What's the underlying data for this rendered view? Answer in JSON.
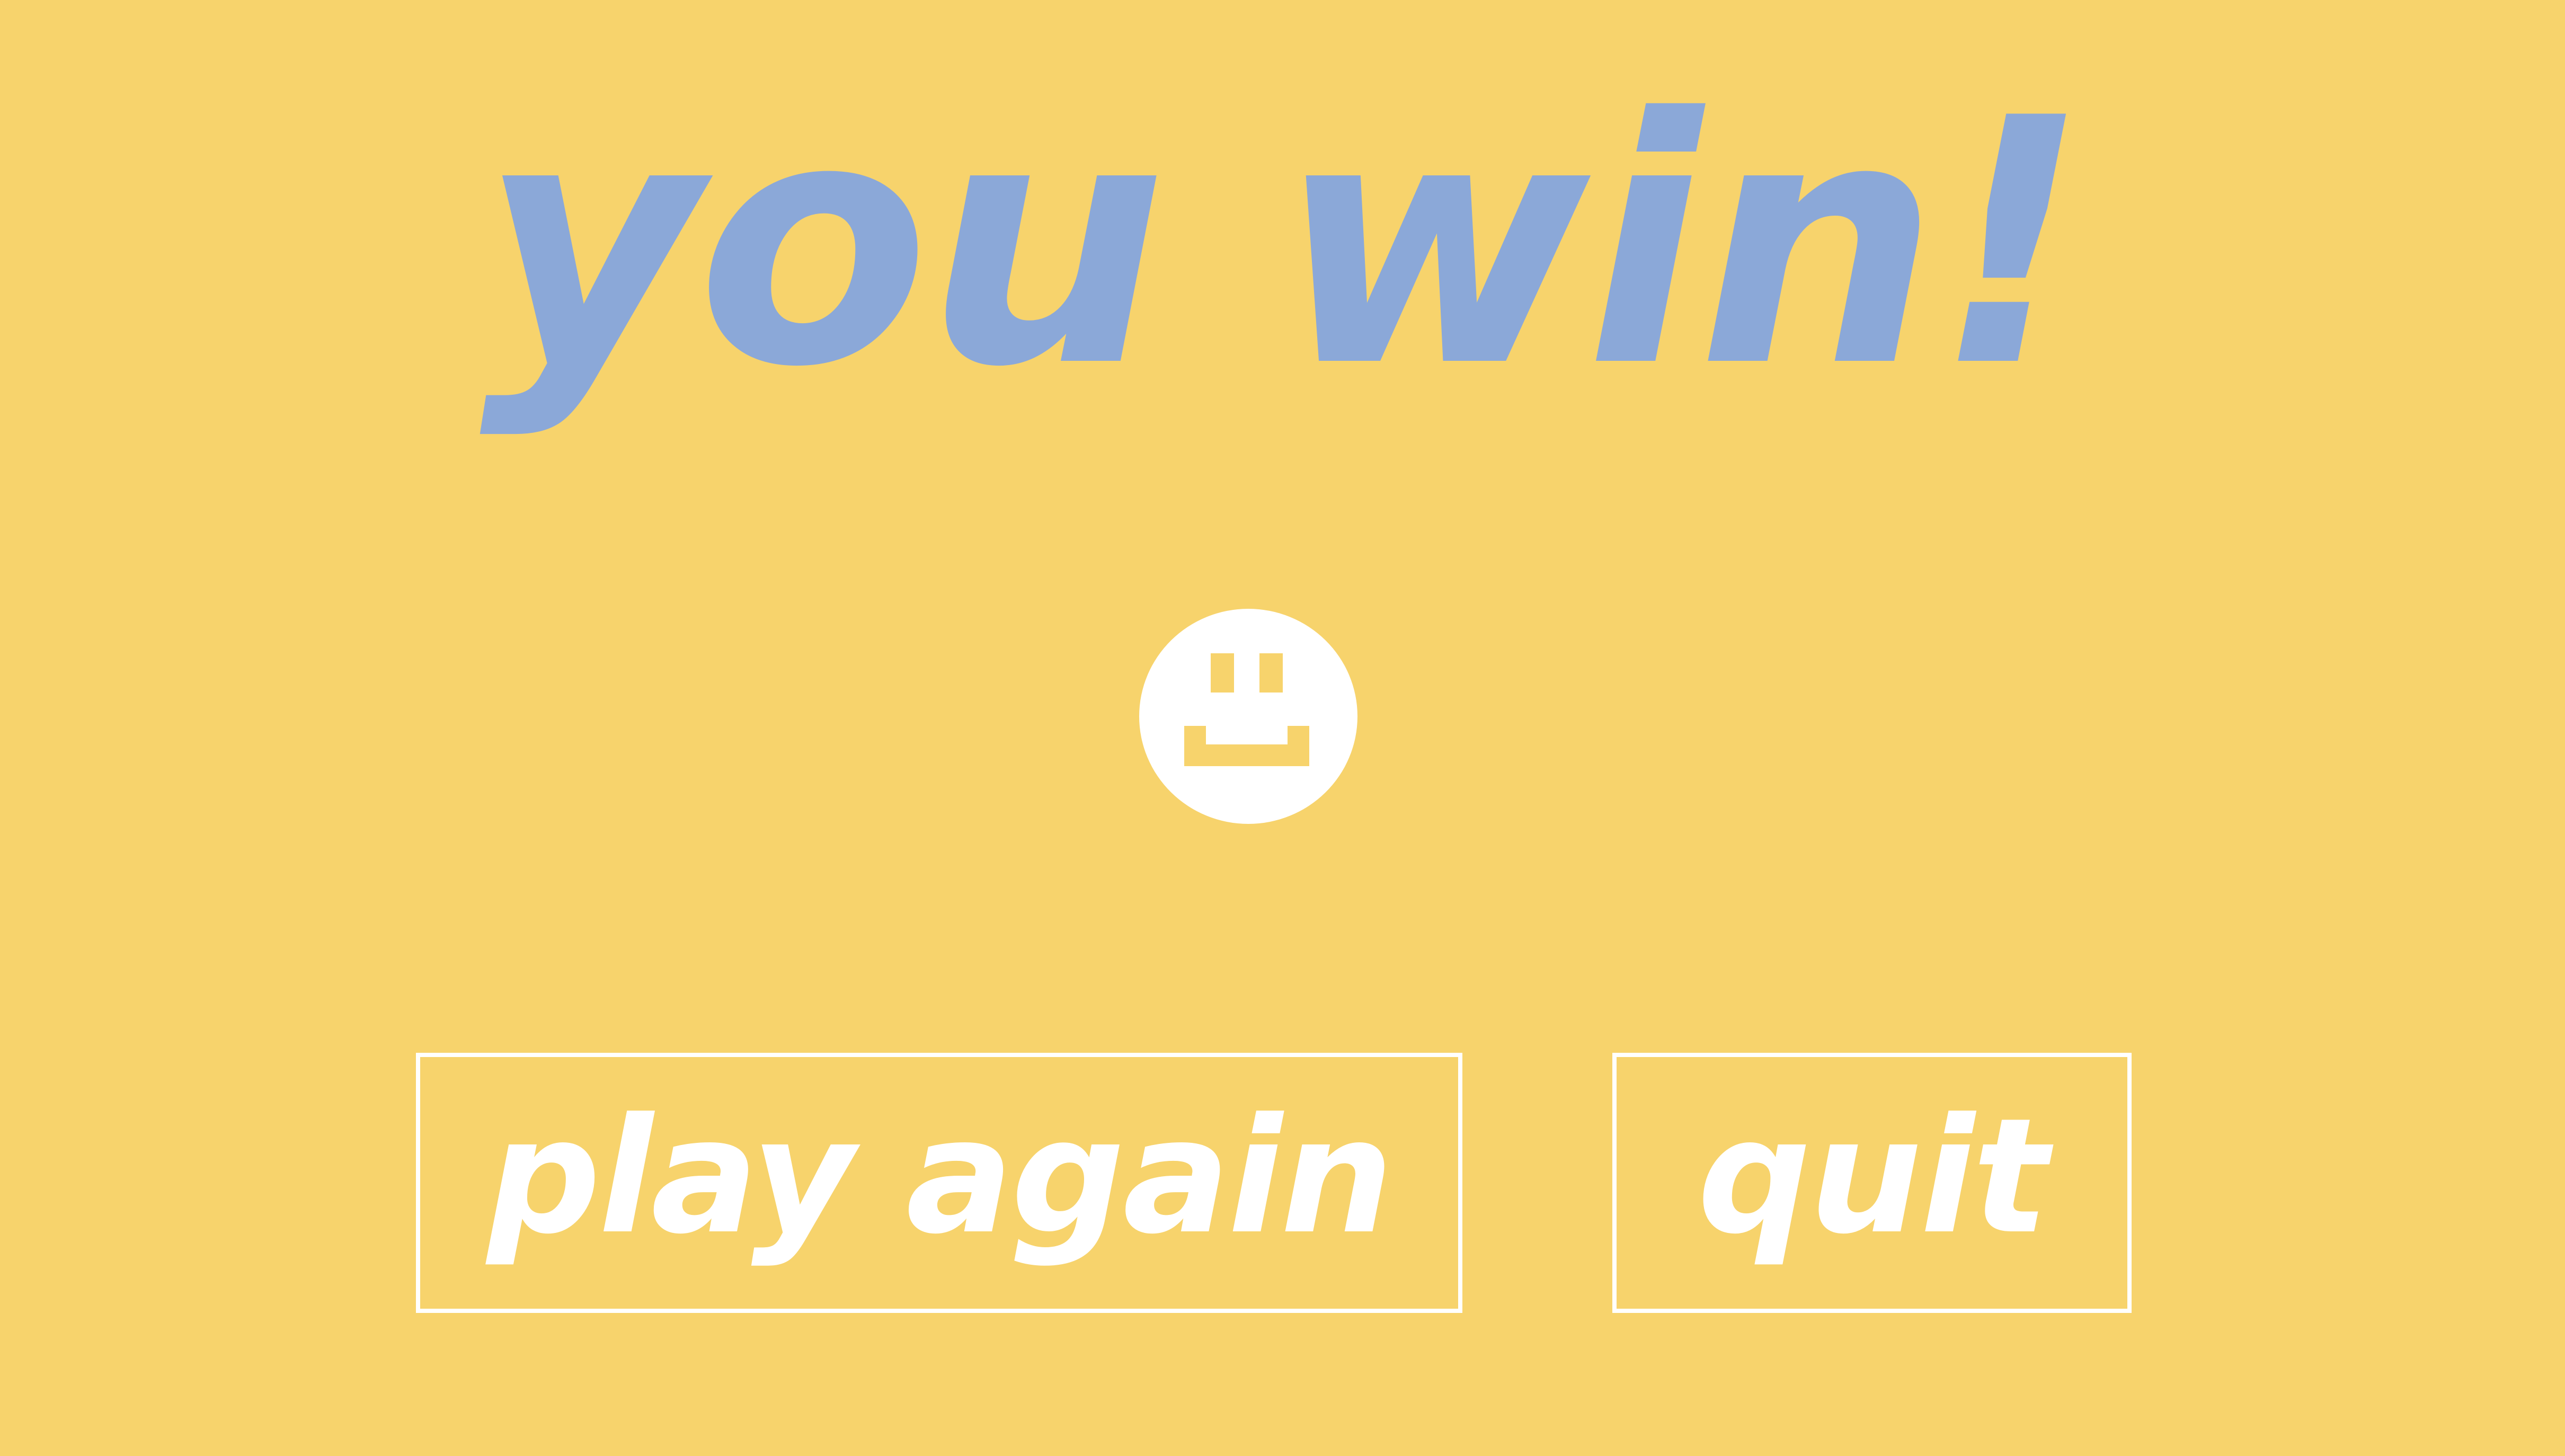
{
  "result": {
    "title": "you win!"
  },
  "face": {
    "icon": "smiley-face-icon",
    "color": "#FFFFFF"
  },
  "buttons": {
    "play_again_label": "play again",
    "quit_label": "quit"
  },
  "colors": {
    "background": "#F7D36C",
    "title": "#8BA8D8",
    "button": "#FFFFFF"
  }
}
